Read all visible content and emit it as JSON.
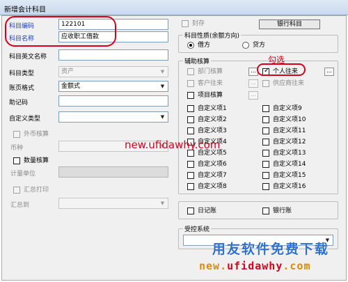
{
  "window": {
    "title": "新增会计科目"
  },
  "left": {
    "code_label": "科目编码",
    "code_value": "122101",
    "name_label": "科目名称",
    "name_value": "应收职工借款",
    "english_label": "科目英文名称",
    "english_value": "",
    "type_label": "科目类型",
    "type_value": "资产",
    "format_label": "账页格式",
    "format_value": "金额式",
    "mnemonic_label": "助记码",
    "mnemonic_value": "",
    "custom_type_label": "自定义类型",
    "custom_type_value": "",
    "foreign_label": "外币核算",
    "currency_label": "币种",
    "currency_value": "",
    "quantity_label": "数量核算",
    "unit_label": "计量单位",
    "unit_value": "",
    "summary_print_label": "汇总打印",
    "summary_to_label": "汇总到",
    "summary_to_value": ""
  },
  "right": {
    "seal_label": "封存",
    "bank_subject_button": "银行科目",
    "nature_legend": "科目性质(余额方向)",
    "debit_label": "借方",
    "credit_label": "贷方",
    "aux_legend": "辅助核算",
    "dept_label": "部门核算",
    "personal_label": "个人往来",
    "customer_label": "客户往来",
    "supplier_label": "供应商往来",
    "project_label": "项目核算",
    "custom_items_left": [
      "自定义项1",
      "自定义项2",
      "自定义项3",
      "自定义项4",
      "自定义项5",
      "自定义项6",
      "自定义项7",
      "自定义项8"
    ],
    "custom_items_right": [
      "自定义项9",
      "自定义项10",
      "自定义项11",
      "自定义项12",
      "自定义项13",
      "自定义项14",
      "自定义项15",
      "自定义项16"
    ],
    "journal_label": "日记账",
    "bank_journal_label": "银行账",
    "controlled_legend": "受控系统",
    "controlled_value": "",
    "ellipsis": "..."
  },
  "state": {
    "debit_selected": true,
    "personal_checked": true
  },
  "annotations": {
    "tick_note": "勾选"
  },
  "watermark": {
    "url_center": "new.ufidawhy.com",
    "brand_cn": "用友软件免费下载",
    "url_prefix": "new.",
    "url_mid": "ufidawhy",
    "url_suffix": ".com"
  },
  "colors": {
    "annotation_red": "#d6001c",
    "label_blue": "#1a3ecf",
    "watermark_blue": "#2f6fd0",
    "watermark_orange": "#e08a00"
  }
}
